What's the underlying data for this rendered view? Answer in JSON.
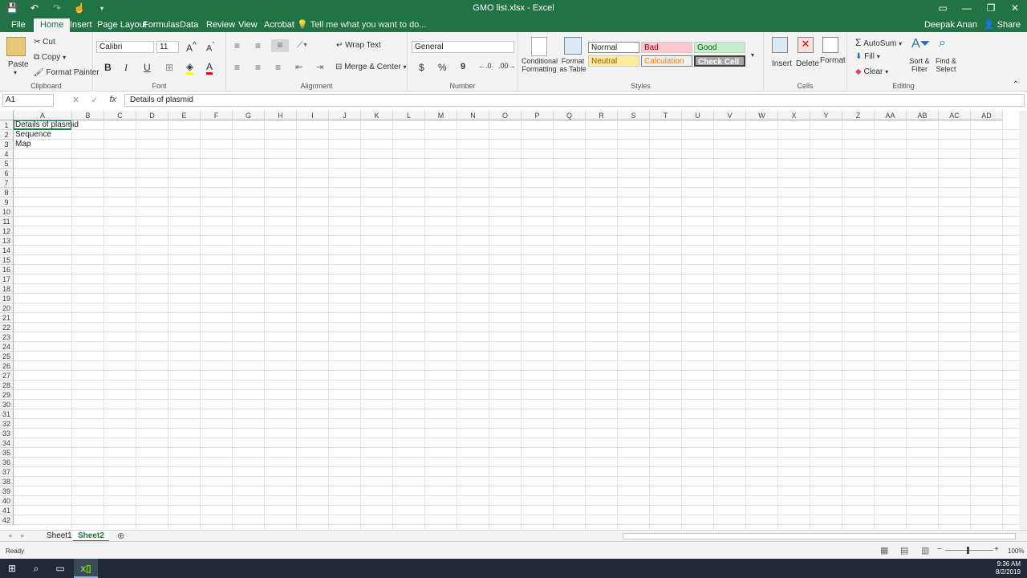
{
  "window": {
    "title": "GMO list.xlsx - Excel"
  },
  "tabs": [
    {
      "label": "File"
    },
    {
      "label": "Home"
    },
    {
      "label": "Insert"
    },
    {
      "label": "Page Layout"
    },
    {
      "label": "Formulas"
    },
    {
      "label": "Data"
    },
    {
      "label": "Review"
    },
    {
      "label": "View"
    },
    {
      "label": "Acrobat"
    }
  ],
  "tell_me": "Tell me what you want to do...",
  "user_name": "Deepak Anan",
  "share_label": "Share",
  "ribbon": {
    "clipboard": {
      "paste": "Paste",
      "cut": "Cut",
      "copy": "Copy",
      "format_painter": "Format Painter",
      "label": "Clipboard"
    },
    "font": {
      "name": "Calibri",
      "size": "11",
      "label": "Font",
      "bold": "B",
      "italic": "I",
      "underline": "U"
    },
    "alignment": {
      "wrap": "Wrap Text",
      "merge": "Merge & Center",
      "label": "Alignment"
    },
    "number": {
      "format": "General",
      "label": "Number",
      "currency": "$",
      "percent": "%",
      "comma": "9"
    },
    "styles": {
      "conditional": "Conditional Formatting",
      "format_table": "Format as Table",
      "normal": "Normal",
      "bad": "Bad",
      "good": "Good",
      "neutral": "Neutral",
      "calculation": "Calculation",
      "check_cell": "Check Cell",
      "label": "Styles"
    },
    "cells": {
      "insert": "Insert",
      "delete": "Delete",
      "format": "Format",
      "label": "Cells"
    },
    "editing": {
      "autosum": "AutoSum",
      "fill": "Fill",
      "clear": "Clear",
      "sort": "Sort & Filter",
      "find": "Find & Select",
      "label": "Editing"
    }
  },
  "formula_bar": {
    "name_box": "A1",
    "fx": "fx",
    "content": "Details of plasmid"
  },
  "columns": [
    "A",
    "B",
    "C",
    "D",
    "E",
    "F",
    "G",
    "H",
    "I",
    "J",
    "K",
    "L",
    "M",
    "N",
    "O",
    "P",
    "Q",
    "R",
    "S",
    "T",
    "U",
    "V",
    "W",
    "X",
    "Y",
    "Z",
    "AA",
    "AB",
    "AC",
    "AD"
  ],
  "rows": [
    "1",
    "2",
    "3",
    "4",
    "5",
    "6",
    "7",
    "8",
    "9",
    "10",
    "11",
    "12",
    "13",
    "14",
    "15",
    "16",
    "17",
    "18",
    "19",
    "20",
    "21",
    "22",
    "23",
    "24",
    "25",
    "26",
    "27",
    "28",
    "29",
    "30",
    "31",
    "32",
    "33",
    "34",
    "35",
    "36",
    "37",
    "38",
    "39",
    "40",
    "41",
    "42"
  ],
  "cells": [
    {
      "ref": "A1",
      "value": "Details of plasmid"
    },
    {
      "ref": "A2",
      "value": "Sequence"
    },
    {
      "ref": "A3",
      "value": "Map"
    }
  ],
  "sheets": [
    {
      "name": "Sheet1",
      "active": false
    },
    {
      "name": "Sheet2",
      "active": true
    }
  ],
  "status": {
    "ready": "Ready",
    "zoom": "100%"
  },
  "clock": {
    "time": "9:36 AM",
    "date": "8/2/2019"
  },
  "colors": {
    "excel_green": "#217346",
    "bad_bg": "#ffc7ce",
    "good_bg": "#c6efce",
    "neutral_bg": "#ffeb9c"
  }
}
